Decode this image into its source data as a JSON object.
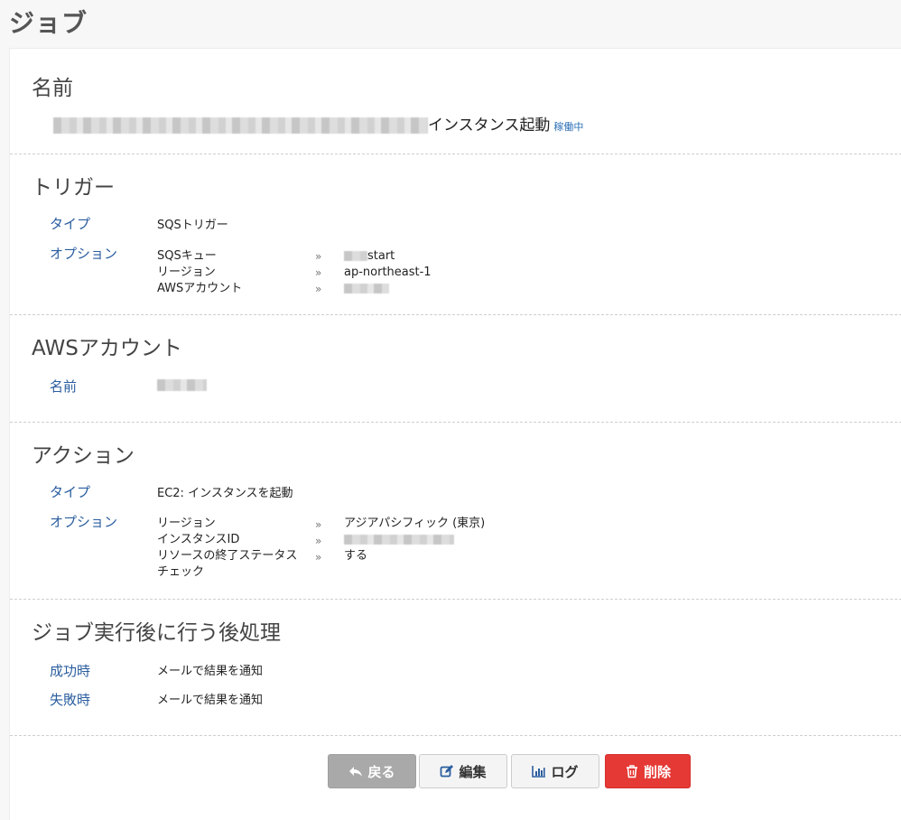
{
  "page": {
    "title": "ジョブ"
  },
  "name_section": {
    "title": "名前",
    "job_name_suffix": "インスタンス起動",
    "status": "稼働中"
  },
  "trigger_section": {
    "title": "トリガー",
    "type_label": "タイプ",
    "type_value": "SQSトリガー",
    "options_label": "オプション",
    "options": [
      {
        "key": "SQSキュー",
        "value": "start",
        "value_redacted_prefix": true
      },
      {
        "key": "リージョン",
        "value": "ap-northeast-1"
      },
      {
        "key": "AWSアカウント",
        "value": "",
        "value_redacted": true
      }
    ]
  },
  "aws_section": {
    "title": "AWSアカウント",
    "name_label": "名前"
  },
  "action_section": {
    "title": "アクション",
    "type_label": "タイプ",
    "type_value": "EC2: インスタンスを起動",
    "options_label": "オプション",
    "options": [
      {
        "key": "リージョン",
        "value": "アジアパシフィック (東京)"
      },
      {
        "key": "インスタンスID",
        "value": "",
        "value_redacted": true
      },
      {
        "key": "リソースの終了ステータス",
        "key_line2": "チェック",
        "value": "する"
      }
    ]
  },
  "post_section": {
    "title": "ジョブ実行後に行う後処理",
    "success_label": "成功時",
    "success_value": "メールで結果を通知",
    "failure_label": "失敗時",
    "failure_value": "メールで結果を通知"
  },
  "buttons": {
    "back": "戻る",
    "edit": "編集",
    "log": "ログ",
    "delete": "削除"
  },
  "colors": {
    "label_blue": "#2a5d9f",
    "status_blue": "#2a6fb5",
    "back_gray": "#a9a9a9",
    "delete_red": "#e53935"
  }
}
